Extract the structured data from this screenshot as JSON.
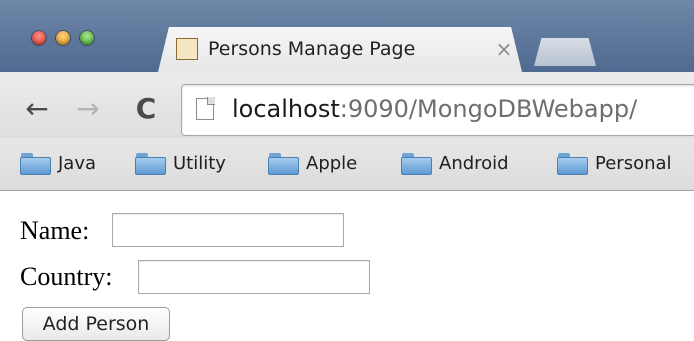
{
  "window": {
    "buttons": [
      "close",
      "minimize",
      "zoom"
    ]
  },
  "tabs": [
    {
      "title": "Persons Manage Page",
      "favicon": "app-favicon-icon",
      "close_glyph": "×",
      "active": true
    }
  ],
  "toolbar": {
    "back_glyph": "←",
    "forward_glyph": "→",
    "reload_glyph": "C",
    "url_host": "localhost",
    "url_rest": ":9090/MongoDBWebapp/"
  },
  "bookmarks": [
    {
      "label": "Java",
      "icon": "folder-icon"
    },
    {
      "label": "Utility",
      "icon": "folder-icon"
    },
    {
      "label": "Apple",
      "icon": "folder-icon"
    },
    {
      "label": "Android",
      "icon": "folder-icon"
    },
    {
      "label": "Personal",
      "icon": "folder-icon"
    }
  ],
  "form": {
    "name_label": "Name:",
    "name_value": "",
    "country_label": "Country:",
    "country_value": "",
    "submit_label": "Add Person"
  }
}
